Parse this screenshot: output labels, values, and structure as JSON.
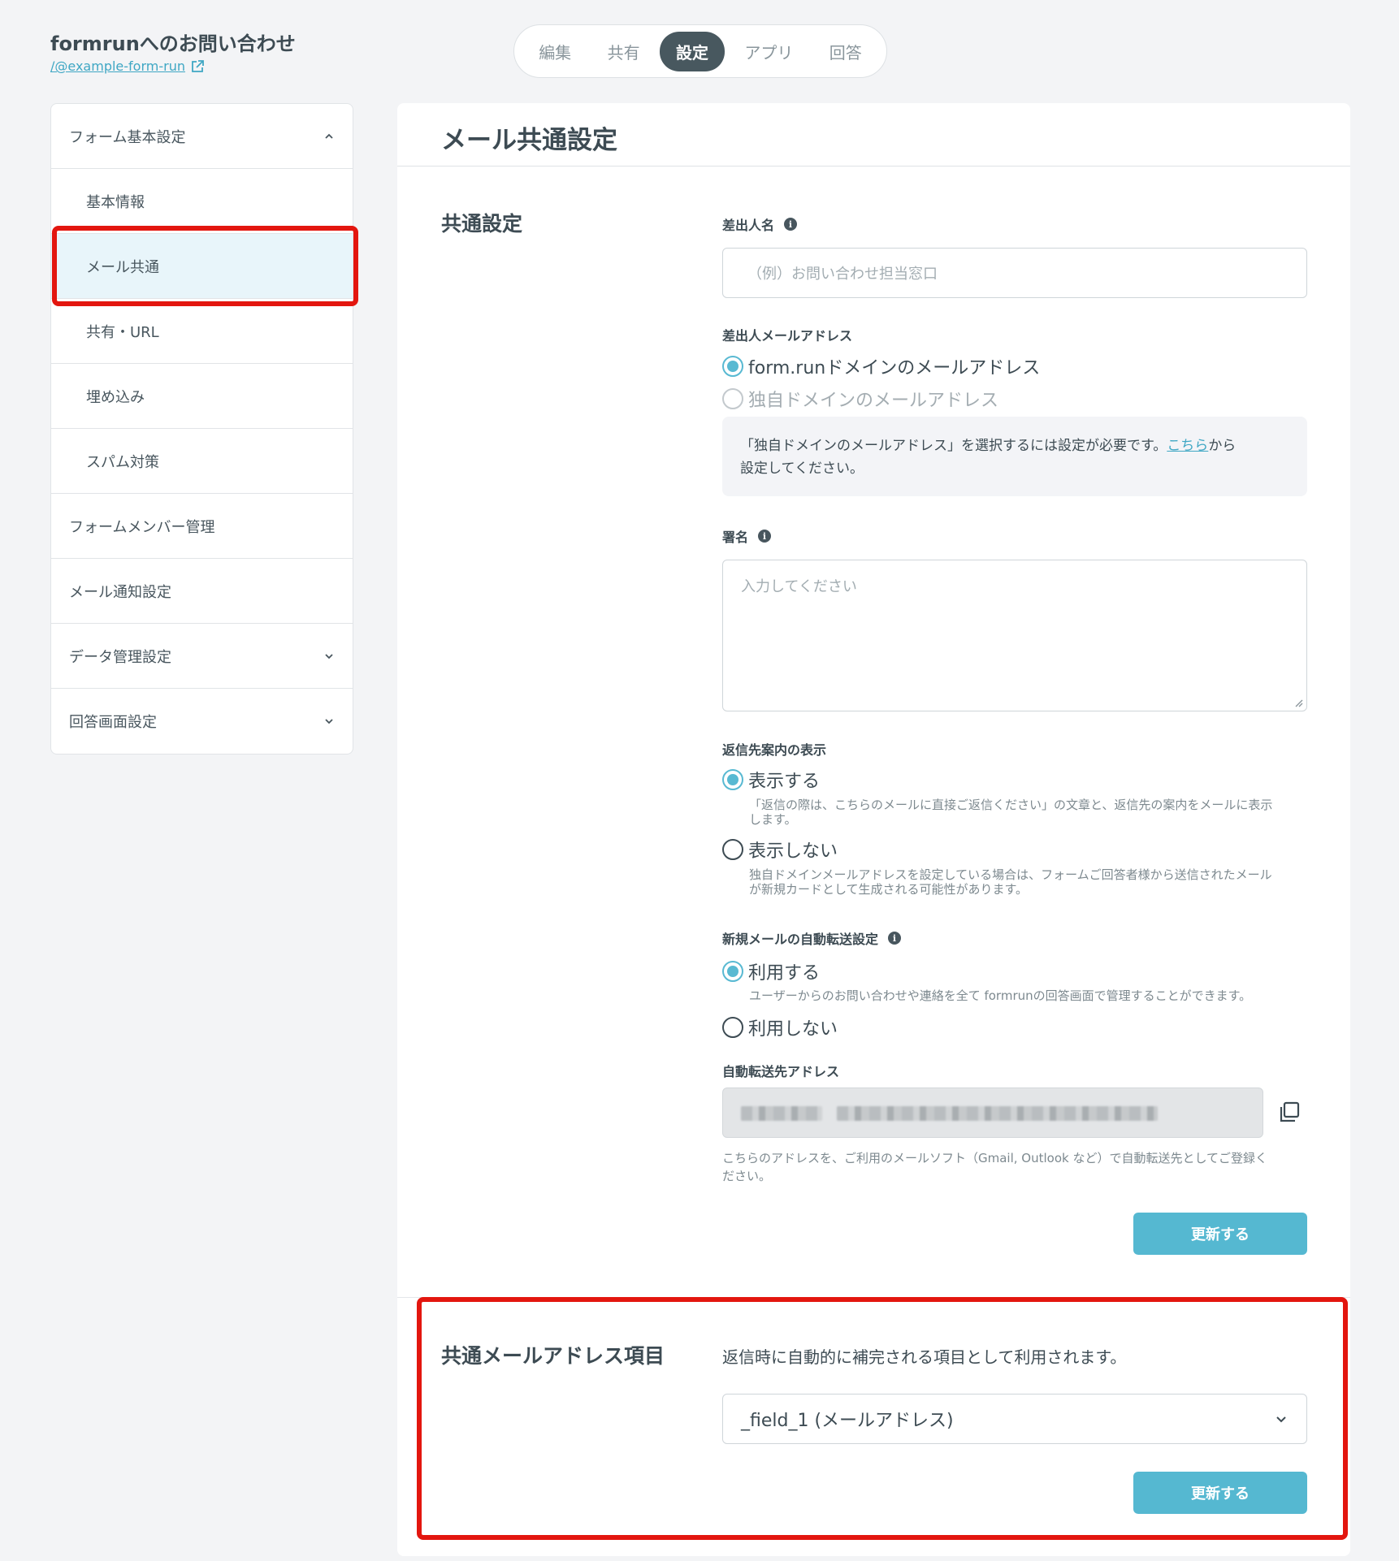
{
  "header": {
    "form_title": "formrunへのお問い合わせ",
    "form_link": "/@example-form-run"
  },
  "tabs": [
    {
      "label": "編集"
    },
    {
      "label": "共有"
    },
    {
      "label": "設定",
      "active": true
    },
    {
      "label": "アプリ"
    },
    {
      "label": "回答"
    }
  ],
  "sidebar": {
    "items": [
      {
        "label": "フォーム基本設定",
        "chevron": "up"
      },
      {
        "label": "基本情報"
      },
      {
        "label": "メール共通",
        "active": true
      },
      {
        "label": "共有・URL"
      },
      {
        "label": "埋め込み"
      },
      {
        "label": "スパム対策"
      },
      {
        "label": "フォームメンバー管理"
      },
      {
        "label": "メール通知設定"
      },
      {
        "label": "データ管理設定",
        "chevron": "down"
      },
      {
        "label": "回答画面設定",
        "chevron": "down"
      }
    ]
  },
  "main": {
    "title": "メール共通設定",
    "common": {
      "section_title": "共通設定",
      "sender_name_label": "差出人名",
      "sender_name_placeholder": "（例）お問い合わせ担当窓口",
      "sender_email_label": "差出人メールアドレス",
      "sender_email_options": [
        {
          "label": "form.runドメインのメールアドレス",
          "checked": true
        },
        {
          "label": "独自ドメインのメールアドレス",
          "disabled": true
        }
      ],
      "notice_prefix": "「独自ドメインのメールアドレス」を選択するには設定が必要です。",
      "notice_link": "こちら",
      "notice_suffix_1": "から",
      "notice_suffix_2": "設定してください。",
      "signature_label": "署名",
      "signature_placeholder": "入力してください",
      "reply_label": "返信先案内の表示",
      "reply_options": [
        {
          "label": "表示する",
          "checked": true,
          "help_1": "「返信の際は、こちらのメールに直接ご返信ください」の文章と、返信先の案内をメールに表示",
          "help_2": "します。"
        },
        {
          "label": "表示しない",
          "help_1": "独自ドメインメールアドレスを設定している場合は、フォームご回答者様から送信されたメール",
          "help_2": "が新規カードとして生成される可能性があります。"
        }
      ],
      "forward_label": "新規メールの自動転送設定",
      "forward_options": [
        {
          "label": "利用する",
          "checked": true,
          "help": "ユーザーからのお問い合わせや連絡を全て formrunの回答画面で管理することができます。"
        },
        {
          "label": "利用しない"
        }
      ],
      "forward_address_label": "自動転送先アドレス",
      "forward_address_help_1": "こちらのアドレスを、ご利用のメールソフト（Gmail, Outlook など）で自動転送先としてご登録く",
      "forward_address_help_2": "ださい。",
      "update_button": "更新する"
    },
    "email_field": {
      "section_title": "共通メールアドレス項目",
      "description": "返信時に自動的に補完される項目として利用されます。",
      "selected_value": "_field_1 (メールアドレス)",
      "update_button": "更新する"
    }
  },
  "colors": {
    "accent": "#55b8d1",
    "highlight_border": "#e3160f",
    "active_tab_bg": "#48585f"
  }
}
